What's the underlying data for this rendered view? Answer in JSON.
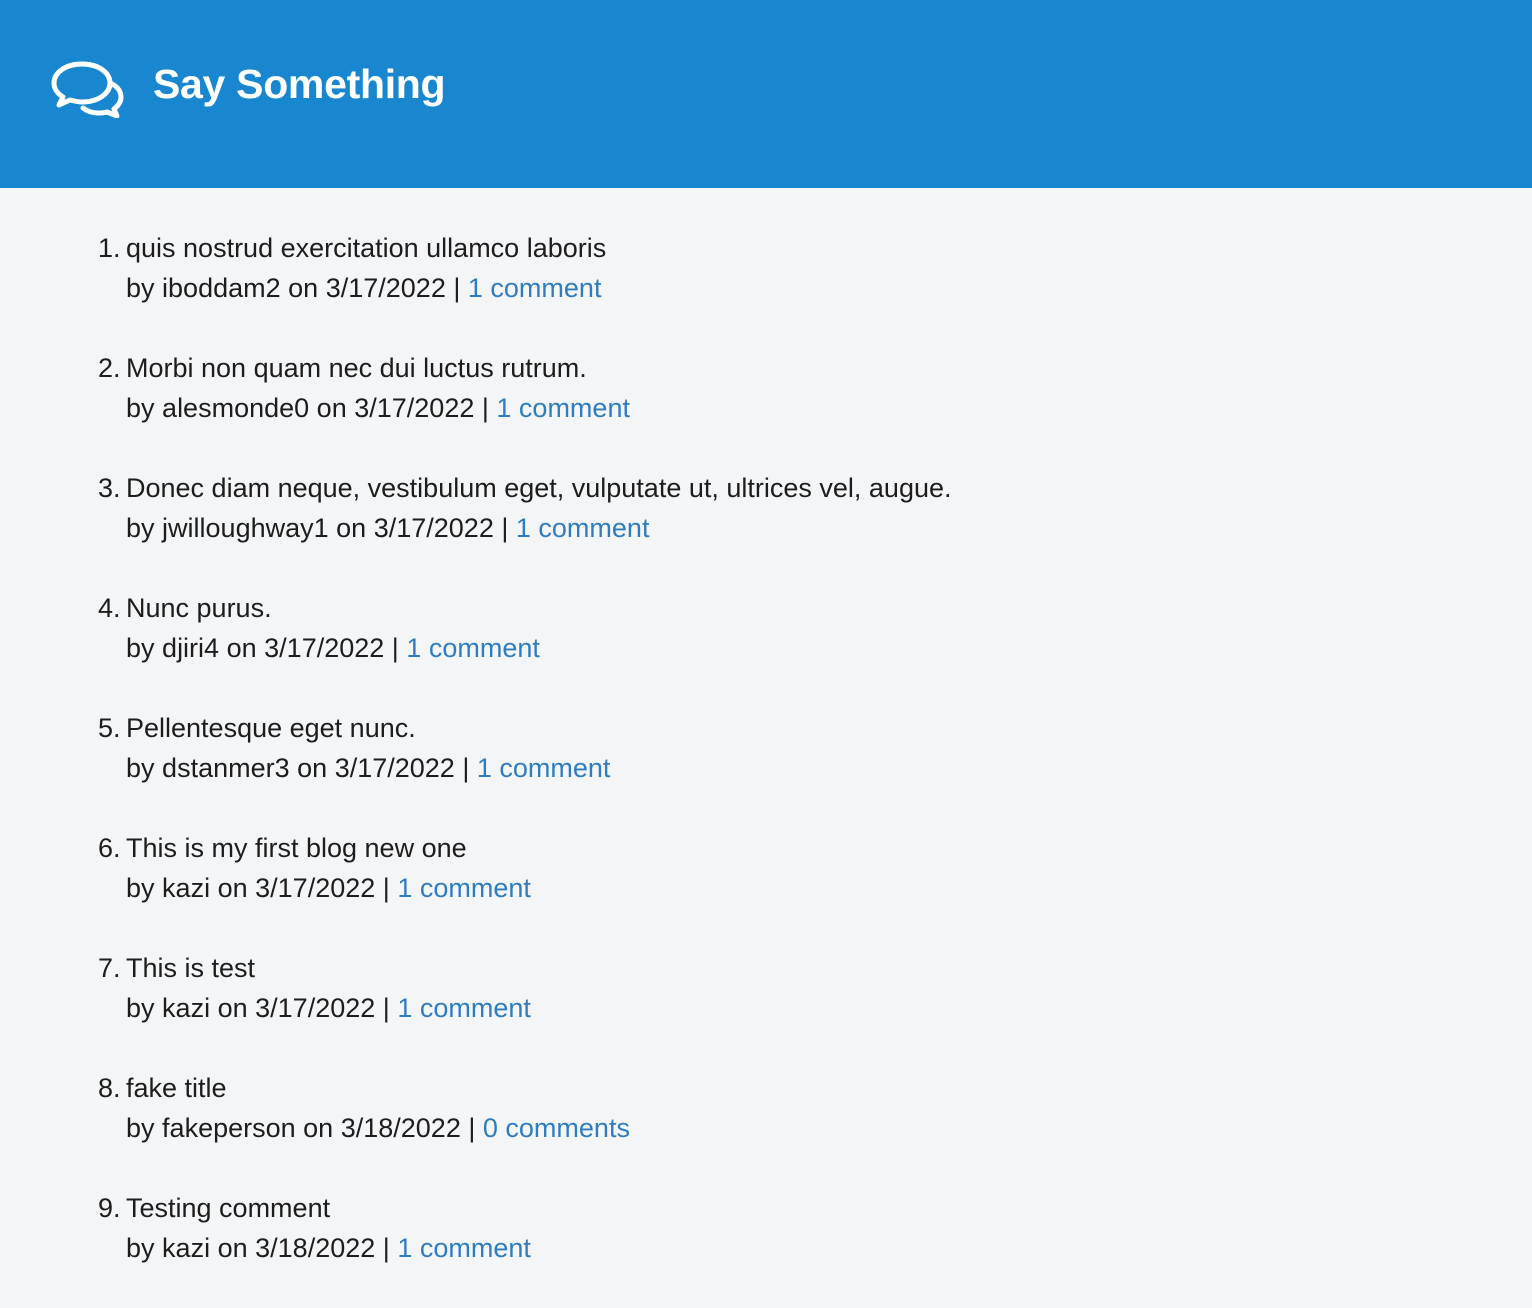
{
  "header": {
    "title": "Say Something",
    "icon": "speech-bubbles-icon",
    "background_color": "#1887cf"
  },
  "link_color": "#2f7dbf",
  "posts": [
    {
      "number": "1.",
      "title": "quis nostrud exercitation ullamco laboris",
      "by": "by",
      "author": "iboddam2",
      "on": "on",
      "date": "3/17/2022",
      "separator": "|",
      "comments": "1 comment"
    },
    {
      "number": "2.",
      "title": "Morbi non quam nec dui luctus rutrum.",
      "by": "by",
      "author": "alesmonde0",
      "on": "on",
      "date": "3/17/2022",
      "separator": "|",
      "comments": "1 comment"
    },
    {
      "number": "3.",
      "title": "Donec diam neque, vestibulum eget, vulputate ut, ultrices vel, augue.",
      "by": "by",
      "author": "jwilloughway1",
      "on": "on",
      "date": "3/17/2022",
      "separator": "|",
      "comments": "1 comment"
    },
    {
      "number": "4.",
      "title": "Nunc purus.",
      "by": "by",
      "author": "djiri4",
      "on": "on",
      "date": "3/17/2022",
      "separator": "|",
      "comments": "1 comment"
    },
    {
      "number": "5.",
      "title": "Pellentesque eget nunc.",
      "by": "by",
      "author": "dstanmer3",
      "on": "on",
      "date": "3/17/2022",
      "separator": "|",
      "comments": "1 comment"
    },
    {
      "number": "6.",
      "title": "This is my first blog new one",
      "by": "by",
      "author": "kazi",
      "on": "on",
      "date": "3/17/2022",
      "separator": "|",
      "comments": "1 comment"
    },
    {
      "number": "7.",
      "title": "This is test",
      "by": "by",
      "author": "kazi",
      "on": "on",
      "date": "3/17/2022",
      "separator": "|",
      "comments": "1 comment"
    },
    {
      "number": "8.",
      "title": "fake title",
      "by": "by",
      "author": "fakeperson",
      "on": "on",
      "date": "3/18/2022",
      "separator": "|",
      "comments": "0 comments"
    },
    {
      "number": "9.",
      "title": "Testing comment",
      "by": "by",
      "author": "kazi",
      "on": "on",
      "date": "3/18/2022",
      "separator": "|",
      "comments": "1 comment"
    }
  ]
}
